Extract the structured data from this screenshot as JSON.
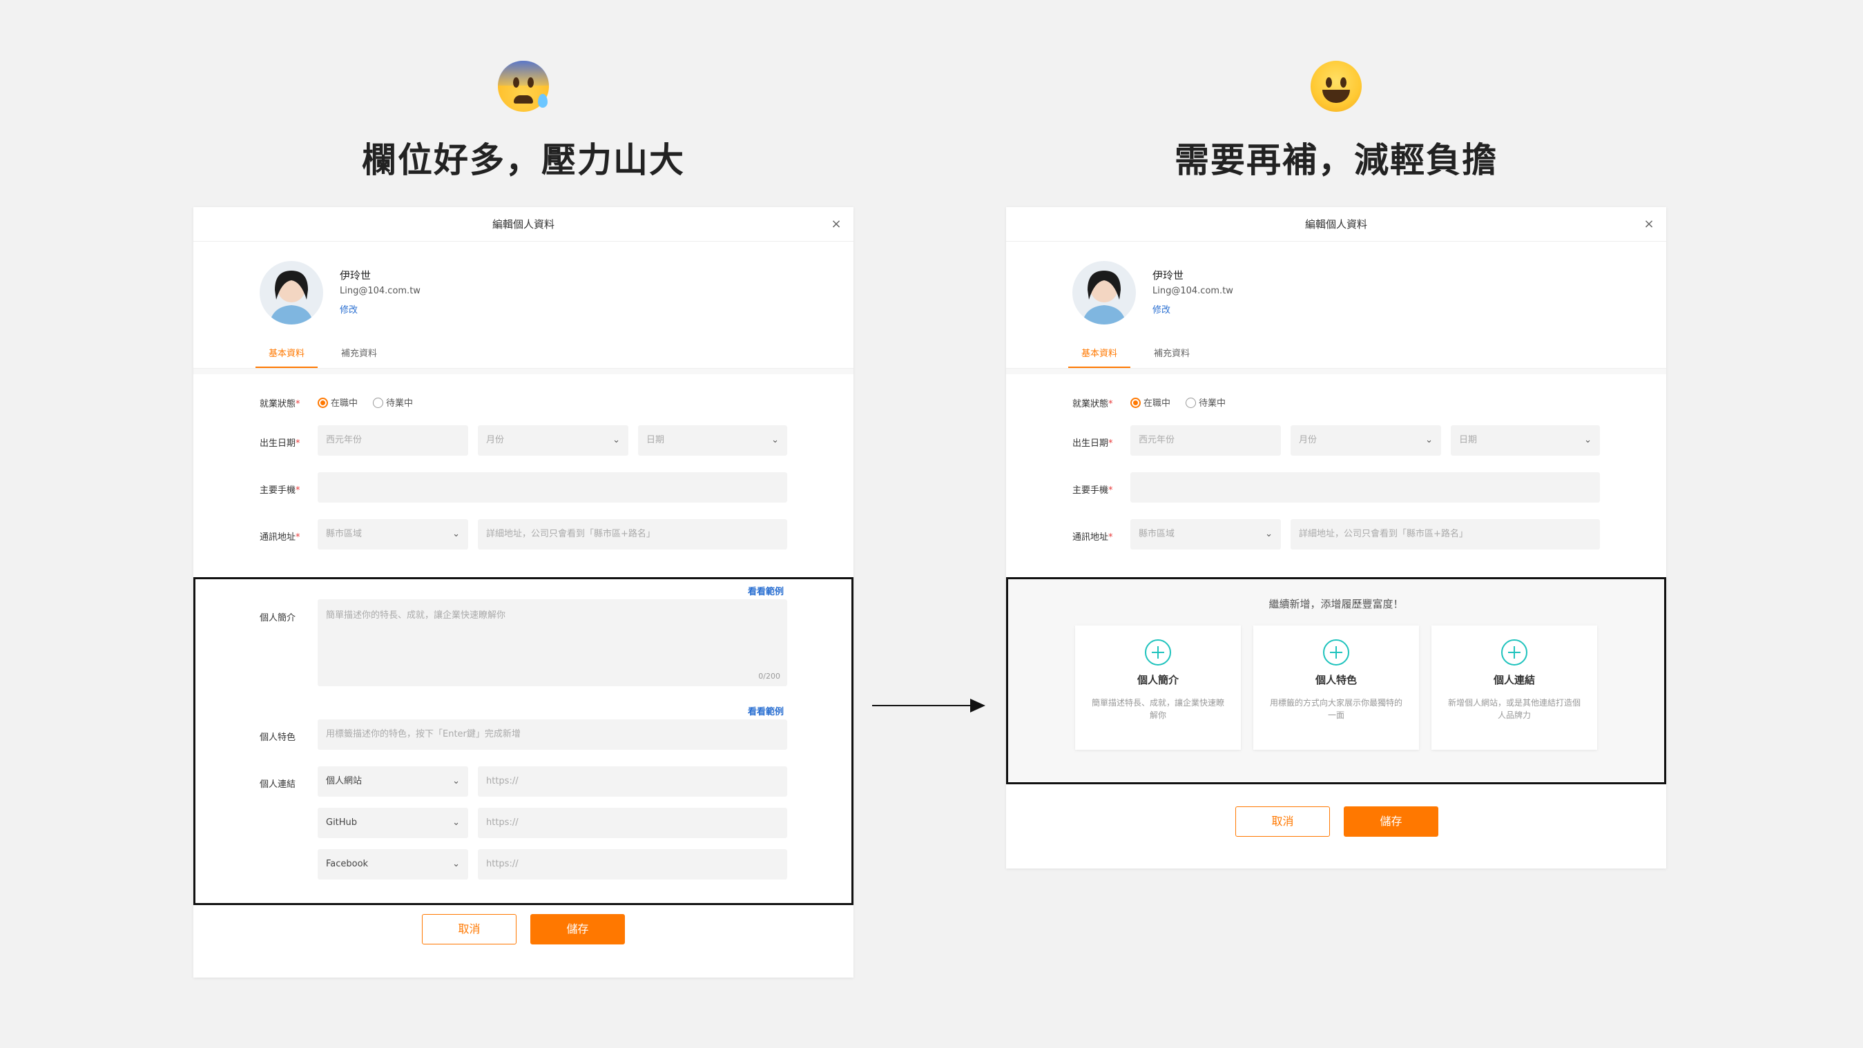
{
  "left_heading": "欄位好多，壓力山大",
  "right_heading": "需要再補，減輕負擔",
  "dialog": {
    "title": "編輯個人資料",
    "close": "×",
    "profile": {
      "name": "伊玲世",
      "email": "Ling@104.com.tw",
      "edit": "修改"
    },
    "tabs": [
      "基本資料",
      "補充資料"
    ],
    "employment": {
      "label": "就業狀態",
      "opt1": "在職中",
      "opt2": "待業中"
    },
    "birthday": {
      "label": "出生日期",
      "year": "西元年份",
      "month": "月份",
      "day": "日期"
    },
    "phone": {
      "label": "主要手機"
    },
    "address": {
      "label": "通訊地址",
      "region": "縣市區域",
      "detail": "詳細地址，公司只會看到「縣市區+路名」"
    },
    "required_mark": "*",
    "chevron": "⌄"
  },
  "left_extra": {
    "see_example": "看看範例",
    "intro_label": "個人簡介",
    "intro_placeholder": "簡單描述你的特長、成就，讓企業快速瞭解你",
    "intro_counter": "0/200",
    "feature_label": "個人特色",
    "feature_placeholder": "用標籤描述你的特色，按下「Enter鍵」完成新增",
    "links_label": "個人連結",
    "links": [
      {
        "type": "個人網站",
        "url": "https://"
      },
      {
        "type": "GitHub",
        "url": "https://"
      },
      {
        "type": "Facebook",
        "url": "https://"
      }
    ]
  },
  "right_extra": {
    "add_title": "繼續新增，添增履歷豐富度！",
    "cards": [
      {
        "name": "個人簡介",
        "desc": "簡單描述特長、成就，讓企業快速瞭解你"
      },
      {
        "name": "個人特色",
        "desc": "用標籤的方式向大家展示你最獨特的一面"
      },
      {
        "name": "個人連結",
        "desc": "新增個人網站，或是其他連結打造個人品牌力"
      }
    ]
  },
  "buttons": {
    "cancel": "取消",
    "save": "儲存"
  },
  "colors": {
    "accent": "#ff7800",
    "link": "#2a6fd1",
    "plus": "#1fc3bd"
  }
}
